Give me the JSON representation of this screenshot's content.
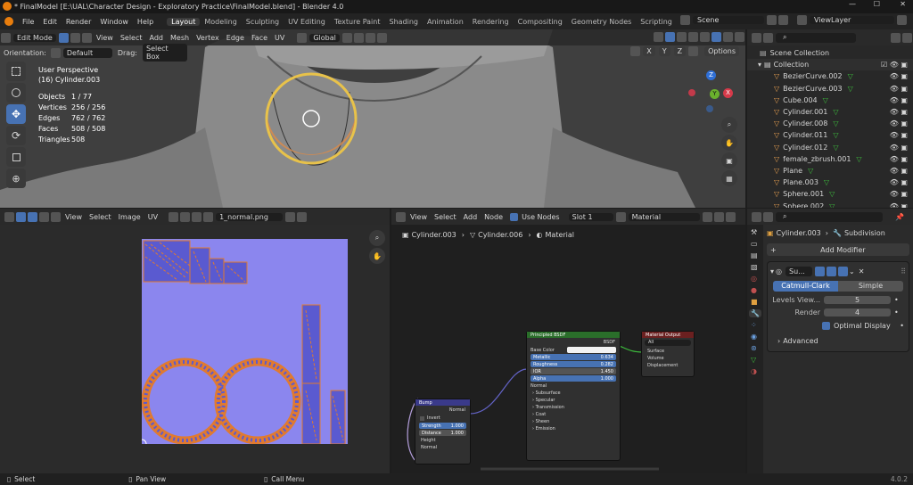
{
  "window": {
    "title": "* FinalModel [E:\\UAL\\Character Design - Exploratory Practice\\FinalModel.blend] - Blender 4.0"
  },
  "menu": [
    "File",
    "Edit",
    "Render",
    "Window",
    "Help"
  ],
  "workspace_tabs": [
    "Layout",
    "Modeling",
    "Sculpting",
    "UV Editing",
    "Texture Paint",
    "Shading",
    "Animation",
    "Rendering",
    "Compositing",
    "Geometry Nodes",
    "Scripting"
  ],
  "scene": "Scene",
  "view_layer": "ViewLayer",
  "viewport": {
    "mode": "Edit Mode",
    "menus": [
      "View",
      "Select",
      "Add",
      "Mesh",
      "Vertex",
      "Edge",
      "Face",
      "UV"
    ],
    "transform": "Global",
    "orientation_label": "Orientation:",
    "orientation_value": "Default",
    "drag_label": "Drag:",
    "drag_value": "Select Box",
    "options": "Options",
    "axes": [
      "X",
      "Y",
      "Z"
    ],
    "view_name": "User Perspective",
    "object_name": "(16) Cylinder.003",
    "stats": [
      {
        "label": "Objects",
        "value": "1 / 77"
      },
      {
        "label": "Vertices",
        "value": "256 / 256"
      },
      {
        "label": "Edges",
        "value": "762 / 762"
      },
      {
        "label": "Faces",
        "value": "508 / 508"
      },
      {
        "label": "Triangles",
        "value": "508"
      }
    ],
    "gizmo": {
      "z": "Z",
      "y": "Y",
      "x": "X"
    }
  },
  "outliner": {
    "root": "Scene Collection",
    "collection": "Collection",
    "items": [
      "BezierCurve.002",
      "BezierCurve.003",
      "Cube.004",
      "Cylinder.001",
      "Cylinder.008",
      "Cylinder.011",
      "Cylinder.012",
      "female_zbrush.001",
      "Plane",
      "Plane.003",
      "Sphere.001",
      "Sphere.002"
    ]
  },
  "uv_editor": {
    "menus": [
      "View",
      "Select",
      "Image",
      "UV"
    ],
    "image": "1_normal.png"
  },
  "node_editor": {
    "menus": [
      "View",
      "Select",
      "Add",
      "Node"
    ],
    "use_nodes": "Use Nodes",
    "slot": "Slot 1",
    "material": "Material",
    "breadcrumb": [
      "Cylinder.003",
      "Cylinder.006",
      "Material"
    ],
    "bsdf": {
      "title": "Principled BSDF",
      "output": "BSDF",
      "base_color": "Base Color",
      "params": [
        {
          "label": "Metallic",
          "value": "0.634"
        },
        {
          "label": "Roughness",
          "value": "0.282"
        },
        {
          "label": "IOR",
          "value": "1.450"
        },
        {
          "label": "Alpha",
          "value": "1.000"
        }
      ],
      "normal": "Normal",
      "sections": [
        "Subsurface",
        "Specular",
        "Transmission",
        "Coat",
        "Sheen",
        "Emission"
      ]
    },
    "output": {
      "title": "Material Output",
      "target": "All",
      "inputs": [
        "Surface",
        "Volume",
        "Displacement"
      ]
    },
    "bump": {
      "title": "Bump",
      "output": "Normal",
      "invert": "Invert",
      "params": [
        {
          "label": "Strength",
          "value": "1.000"
        },
        {
          "label": "Distance",
          "value": "1.000"
        }
      ],
      "inputs": [
        "Height",
        "Normal"
      ]
    }
  },
  "properties": {
    "object": "Cylinder.003",
    "modifier_crumb": "Subdivision",
    "add_modifier": "Add Modifier",
    "modifier_name": "Su...",
    "algorithms": [
      "Catmull-Clark",
      "Simple"
    ],
    "levels_label": "Levels View...",
    "levels_value": "5",
    "render_label": "Render",
    "render_value": "4",
    "optimal_display": "Optimal Display",
    "advanced": "Advanced"
  },
  "status": {
    "select": "Select",
    "pan": "Pan View",
    "menu": "Call Menu",
    "version": "4.0.2"
  }
}
